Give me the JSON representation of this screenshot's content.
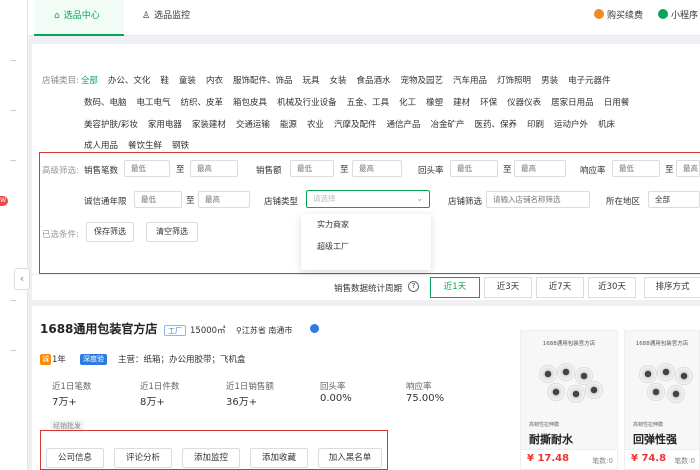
{
  "tabs": [
    {
      "label": "选品中心",
      "icon": "home-icon",
      "active": true
    },
    {
      "label": "选品监控",
      "icon": "user-icon",
      "active": false
    }
  ],
  "topbar": {
    "buy_label": "购买续费",
    "mini_program_label": "小程序"
  },
  "rail": {
    "badge": "W"
  },
  "categories": {
    "label": "店铺类目:",
    "row1": [
      "全部",
      "办公、文化",
      "鞋",
      "童装",
      "内衣",
      "服饰配件、饰品",
      "玩具",
      "女装",
      "食品酒水",
      "宠物及园艺",
      "汽车用品",
      "灯饰照明",
      "男装",
      "电子元器件"
    ],
    "row2": [
      "数码、电脑",
      "电工电气",
      "纺织、皮革",
      "箱包皮具",
      "机械及行业设备",
      "五金、工具",
      "化工",
      "橡塑",
      "建材",
      "环保",
      "仪器仪表",
      "居家日用品",
      "日用餐"
    ],
    "row3": [
      "美容护肤/彩妆",
      "家用电器",
      "家装建材",
      "交通运输",
      "能源",
      "农业",
      "汽摩及配件",
      "通信产品",
      "冶金矿产",
      "医药、保养",
      "印刷",
      "运动户外",
      "机床"
    ],
    "row4": [
      "成人用品",
      "餐饮生鲜",
      "钢铁"
    ]
  },
  "filters": {
    "advanced_label": "高级筛选:",
    "sales_count_label": "销售笔数",
    "sales_amount_label": "销售额",
    "repeat_rate_label": "回头率",
    "response_rate_label": "响应率",
    "integrity_years_label": "诚信通年限",
    "store_type_label": "店铺类型",
    "store_filter_label": "店铺筛选",
    "region_label": "所在地区",
    "min_placeholder": "最低",
    "max_placeholder": "最高",
    "range_sep": "至",
    "select_placeholder": "请选择",
    "store_filter_placeholder": "请输入店铺名称筛选",
    "region_value": "全部",
    "selected_label": "已选条件:",
    "save_label": "保存筛选",
    "clear_label": "清空筛选",
    "store_type_options": [
      "实力商家",
      "超级工厂"
    ]
  },
  "sortbar": {
    "period_label": "销售数据统计周期",
    "periods": [
      "近1天",
      "近3天",
      "近7天",
      "近30天"
    ],
    "sort_label": "排序方式"
  },
  "store": {
    "name": "1688通用包装官方店",
    "type_badge": "工厂",
    "area": "15000㎡",
    "location": "江苏省 南通市",
    "years": "1年",
    "years_prefix": "诚",
    "deep_badge": "深度验",
    "main_products": "主营：纸箱；办公用胶带；飞机盒",
    "stats": [
      {
        "label": "近1日笔数",
        "value": "7万+"
      },
      {
        "label": "近1日件数",
        "value": "8万+"
      },
      {
        "label": "近1日销售额",
        "value": "36万+"
      },
      {
        "label": "回头率",
        "value": "0.00%"
      },
      {
        "label": "响应率",
        "value": "75.00%"
      }
    ],
    "tag": "经销批发",
    "actions": [
      "公司信息",
      "评论分析",
      "添加监控",
      "添加收藏",
      "加入黑名单"
    ]
  },
  "products": [
    {
      "header": "1688通用包装官方店",
      "subtag": "高韧性拉伸膜",
      "title": "耐撕耐水",
      "price": "¥ 17.48",
      "sold": "笔数:0"
    },
    {
      "header": "1688通用包装官方店",
      "subtag": "高韧性拉伸膜",
      "title": "回弹性强",
      "price": "¥ 74.8",
      "sold": "笔数:0"
    }
  ],
  "colors": {
    "accent": "#0aa35a",
    "highlight_box": "#d93636",
    "price": "#e33333"
  }
}
